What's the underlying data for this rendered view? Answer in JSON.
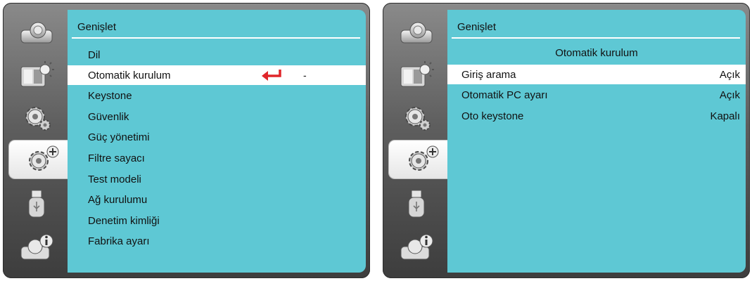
{
  "left_screen": {
    "title": "Genişlet",
    "menu": [
      {
        "label": "Dil"
      },
      {
        "label": "Otomatik kurulum",
        "value": "-"
      },
      {
        "label": "Keystone"
      },
      {
        "label": "Güvenlik"
      },
      {
        "label": "Güç yönetimi"
      },
      {
        "label": "Filtre sayacı"
      },
      {
        "label": "Test modeli"
      },
      {
        "label": "Ağ kurulumu"
      },
      {
        "label": "Denetim kimliği"
      },
      {
        "label": "Fabrika ayarı"
      }
    ],
    "selected_index": 1
  },
  "right_screen": {
    "title": "Genişlet",
    "submenu_title": "Otomatik kurulum",
    "settings": [
      {
        "label": "Giriş arama",
        "value": "Açık"
      },
      {
        "label": "Otomatik PC ayarı",
        "value": "Açık"
      },
      {
        "label": "Oto keystone",
        "value": "Kapalı"
      }
    ],
    "selected_index": 0
  },
  "sidebar_icons": [
    "projector-icon",
    "picture-settings-icon",
    "gear-icon",
    "advanced-gear-icon",
    "usb-icon",
    "info-icon"
  ],
  "active_sidebar_icon": "advanced-gear-icon",
  "colors": {
    "panel": "#5ec8d4",
    "highlight": "#ffffff",
    "enter_arrow": "#e0262a"
  }
}
